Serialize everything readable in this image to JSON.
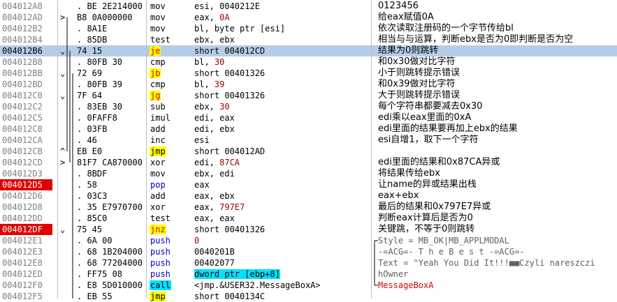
{
  "rows": [
    {
      "addr": "004012A8",
      "jm": "",
      "hex": ". BE 2E214000",
      "mn": "mov",
      "mc": "",
      "op": "esi, 0040212E",
      "opc": "",
      "cm": "0123456",
      "cc": ""
    },
    {
      "addr": "004012AD",
      "jm": ">",
      "hex": "B8 0A000000",
      "mn": "mov",
      "mc": "",
      "op": "eax, 0A",
      "opc": "imm",
      "cm": "给eax赋值0A",
      "cc": ""
    },
    {
      "addr": "004012B2",
      "jm": "",
      "hex": ". 8A1E",
      "mn": "mov",
      "mc": "",
      "op": "bl, byte ptr [esi]",
      "opc": "",
      "cm": "依次读取注册码的一个字节传给bl",
      "cc": ""
    },
    {
      "addr": "004012B4",
      "jm": "",
      "hex": ". 85DB",
      "mn": "test",
      "mc": "",
      "op": "ebx, ebx",
      "opc": "",
      "cm": "相当与与运算，判断ebx是否为0即判断是否为空",
      "cc": ""
    },
    {
      "addr": "004012B6",
      "jm": "⌄",
      "hex": "74 15",
      "mn": "je",
      "mc": "cond",
      "op": "short 004012CD",
      "opc": "",
      "cm": "结果为0则跳转",
      "cc": "",
      "sel": true
    },
    {
      "addr": "004012B8",
      "jm": "",
      "hex": ". 80FB 30",
      "mn": "cmp",
      "mc": "",
      "op": "bl, 30",
      "opc": "imm",
      "cm": "和0x30做对比字符",
      "cc": ""
    },
    {
      "addr": "004012BB",
      "jm": "⌄",
      "hex": "72 69",
      "mn": "jb",
      "mc": "cond",
      "op": "short 00401326",
      "opc": "",
      "cm": "小于则跳转提示错误",
      "cc": ""
    },
    {
      "addr": "004012BD",
      "jm": "",
      "hex": ". 80FB 39",
      "mn": "cmp",
      "mc": "",
      "op": "bl, 39",
      "opc": "imm",
      "cm": "和0x39做对比字符",
      "cc": ""
    },
    {
      "addr": "004012C0",
      "jm": "⌄",
      "hex": "7F 64",
      "mn": "jg",
      "mc": "cond",
      "op": "short 00401326",
      "opc": "",
      "cm": "大于则跳转提示错误",
      "cc": ""
    },
    {
      "addr": "004012C2",
      "jm": "",
      "hex": ". 83EB 30",
      "mn": "sub",
      "mc": "",
      "op": "ebx, 30",
      "opc": "imm",
      "cm": "每个字符串都要减去0x30",
      "cc": ""
    },
    {
      "addr": "004012C5",
      "jm": "",
      "hex": ". 0FAFF8",
      "mn": "imul",
      "mc": "",
      "op": "edi, eax",
      "opc": "",
      "cm": "edi乘以eax里面的0xA",
      "cc": ""
    },
    {
      "addr": "004012C8",
      "jm": "",
      "hex": ". 03FB",
      "mn": "add",
      "mc": "",
      "op": "edi, ebx",
      "opc": "",
      "cm": "edi里面的结果要再加上ebx的结果",
      "cc": ""
    },
    {
      "addr": "004012CA",
      "jm": "",
      "hex": ". 46",
      "mn": "inc",
      "mc": "",
      "op": "esi",
      "opc": "",
      "cm": "esi自增1，取下一个字符",
      "cc": ""
    },
    {
      "addr": "004012CB",
      "jm": "^",
      "hex": "EB E0",
      "mn": "jmp",
      "mc": "jmp",
      "op": "short 004012AD",
      "opc": "",
      "cm": "",
      "cc": ""
    },
    {
      "addr": "004012CD",
      "jm": ">",
      "hex": "81F7 CA870000",
      "mn": "xor",
      "mc": "",
      "op": "edi, 87CA",
      "opc": "imm",
      "cm": "edi里面的结果和0x87CA异或",
      "cc": ""
    },
    {
      "addr": "004012D3",
      "jm": "",
      "hex": ". 8BDF",
      "mn": "mov",
      "mc": "",
      "op": "ebx, edi",
      "opc": "",
      "cm": "将结果传给ebx",
      "cc": ""
    },
    {
      "addr": "004012D5",
      "jm": "",
      "hex": ". 58",
      "mn": "pop",
      "mc": "pop",
      "op": "eax",
      "opc": "",
      "cm": "让name的异或结果出栈",
      "cc": "",
      "hl": true
    },
    {
      "addr": "004012D6",
      "jm": "",
      "hex": ". 03C3",
      "mn": "add",
      "mc": "",
      "op": "eax, ebx",
      "opc": "",
      "cm": "eax+ebx",
      "cc": ""
    },
    {
      "addr": "004012D8",
      "jm": "",
      "hex": ". 35 E7970700",
      "mn": "xor",
      "mc": "",
      "op": "eax, 797E7",
      "opc": "imm",
      "cm": "最后的结果和0x797E7异或",
      "cc": ""
    },
    {
      "addr": "004012DD",
      "jm": "",
      "hex": ". 85C0",
      "mn": "test",
      "mc": "",
      "op": "eax, eax",
      "opc": "",
      "cm": "判断eax计算后是否为0",
      "cc": ""
    },
    {
      "addr": "004012DF",
      "jm": "⌄",
      "hex": "75 45",
      "mn": "jnz",
      "mc": "cond",
      "op": "short 00401326",
      "opc": "",
      "cm": "关键跳，不等于0则跳转",
      "cc": "",
      "hl": true
    },
    {
      "addr": "004012E1",
      "jm": "",
      "hex": ". 6A 00",
      "mn": "push",
      "mc": "push",
      "op": "0",
      "opc": "imm",
      "cm": "Style = MB_OK|MB_APPLMODAL",
      "cc": "ar"
    },
    {
      "addr": "004012E3",
      "jm": "",
      "hex": ". 68 1B204000",
      "mn": "push",
      "mc": "push",
      "op": "0040201B",
      "opc": "",
      "cm": "-=ACG=- T h e   B e s t -=ACG=-",
      "cc": "ar"
    },
    {
      "addr": "004012E8",
      "jm": "",
      "hex": ". 68 77204000",
      "mn": "push",
      "mc": "push",
      "op": "00402077",
      "opc": "",
      "cm": "Text = \"Yeah You Did It!!!■■Czyli nareszczi",
      "cc": "ar"
    },
    {
      "addr": "004012ED",
      "jm": "",
      "hex": ". FF75 08",
      "mn": "push",
      "mc": "push",
      "op": "dword ptr [ebp+8]",
      "opc": "mem",
      "cm": "hOwner",
      "cc": "ar"
    },
    {
      "addr": "004012F0",
      "jm": "",
      "hex": ". E8 5D010000",
      "mn": "call",
      "mc": "call",
      "op": "<jmp.&USER32.MessageBoxA>",
      "opc": "",
      "cm": "MessageBoxA",
      "cc": "red"
    },
    {
      "addr": "004012F5",
      "jm": "",
      "hex": ". EB 55",
      "mn": "jmp",
      "mc": "jmp",
      "op": "short 0040134C",
      "opc": "",
      "cm": "",
      "cc": ""
    }
  ]
}
